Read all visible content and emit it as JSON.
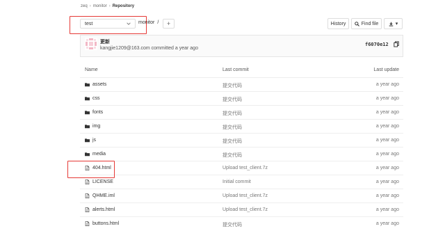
{
  "breadcrumb": {
    "items": [
      "zeq",
      "monitor",
      "Repository"
    ]
  },
  "toolbar": {
    "branch": "test",
    "path_repo": "monitor",
    "path_sep": "/",
    "plus": "+",
    "history_label": "History",
    "find_file_label": "Find file",
    "download_caret": "▾"
  },
  "commit": {
    "title": "更新",
    "meta": "kangjie1209@163.com committed a year ago",
    "sha": "f6070e12"
  },
  "table": {
    "headers": {
      "name": "Name",
      "last_commit": "Last commit",
      "last_update": "Last update"
    },
    "rows": [
      {
        "name": "assets",
        "type": "folder",
        "commit": "提交代码",
        "updated": "a year ago"
      },
      {
        "name": "css",
        "type": "folder",
        "commit": "提交代码",
        "updated": "a year ago"
      },
      {
        "name": "fonts",
        "type": "folder",
        "commit": "提交代码",
        "updated": "a year ago"
      },
      {
        "name": "img",
        "type": "folder",
        "commit": "提交代码",
        "updated": "a year ago"
      },
      {
        "name": "js",
        "type": "folder",
        "commit": "提交代码",
        "updated": "a year ago"
      },
      {
        "name": "media",
        "type": "folder",
        "commit": "提交代码",
        "updated": "a year ago"
      },
      {
        "name": "404.html",
        "type": "file",
        "commit": "Upload test_client.7z",
        "updated": "a year ago"
      },
      {
        "name": "LICENSE",
        "type": "file",
        "commit": "Initial commit",
        "updated": "a year ago"
      },
      {
        "name": "QHME.iml",
        "type": "file",
        "commit": "Upload test_client.7z",
        "updated": "a year ago"
      },
      {
        "name": "alerts.html",
        "type": "file",
        "commit": "Upload test_client.7z",
        "updated": "a year ago"
      },
      {
        "name": "buttons.html",
        "type": "file",
        "commit": "提交代码",
        "updated": "a year ago"
      }
    ]
  },
  "colors": {
    "highlight": "#e53935",
    "border": "#dddddd"
  }
}
